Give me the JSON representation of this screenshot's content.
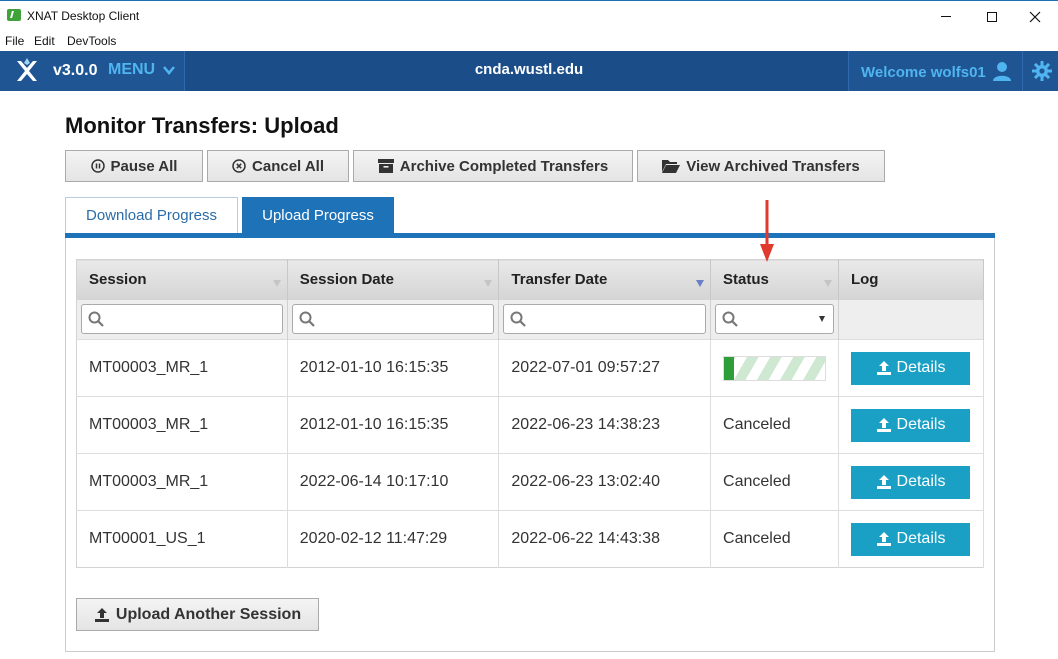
{
  "window": {
    "title": "XNAT Desktop Client",
    "icon": "app-icon",
    "controls": [
      "minimize",
      "maximize",
      "close"
    ]
  },
  "menubar": {
    "items": [
      "File",
      "Edit",
      "DevTools"
    ]
  },
  "appbar": {
    "version": "v3.0.0",
    "menu_label": "MENU",
    "host": "cnda.wustl.edu",
    "welcome": "Welcome wolfs01",
    "colors": {
      "bar": "#1b4e88",
      "accent": "#4fb4ef"
    }
  },
  "page": {
    "title": "Monitor Transfers: Upload",
    "actions": {
      "pause_all": "Pause All",
      "cancel_all": "Cancel All",
      "archive_completed": "Archive Completed Transfers",
      "view_archived": "View Archived Transfers"
    },
    "tabs": [
      {
        "label": "Download Progress",
        "active": false
      },
      {
        "label": "Upload Progress",
        "active": true
      }
    ],
    "upload_another": "Upload Another Session"
  },
  "table": {
    "columns": [
      "Session",
      "Session Date",
      "Transfer Date",
      "Status",
      "Log"
    ],
    "sorted_column": "Transfer Date",
    "sort_direction": "descending",
    "status_filter_value": "",
    "details_label": "Details",
    "rows": [
      {
        "session": "MT00003_MR_1",
        "session_date": "2012-01-10 16:15:35",
        "transfer_date": "2022-07-01 09:57:27",
        "status": "",
        "progress": 0.1
      },
      {
        "session": "MT00003_MR_1",
        "session_date": "2012-01-10 16:15:35",
        "transfer_date": "2022-06-23 14:38:23",
        "status": "Canceled"
      },
      {
        "session": "MT00003_MR_1",
        "session_date": "2022-06-14 10:17:10",
        "transfer_date": "2022-06-23 13:02:40",
        "status": "Canceled"
      },
      {
        "session": "MT00001_US_1",
        "session_date": "2020-02-12 11:47:29",
        "transfer_date": "2022-06-22 14:43:38",
        "status": "Canceled"
      }
    ]
  },
  "colors": {
    "tab_active": "#1e72b8",
    "details_button": "#1aa0c4",
    "progress_fill": "#2e9e3b",
    "annotation_arrow": "#e03a2f"
  }
}
